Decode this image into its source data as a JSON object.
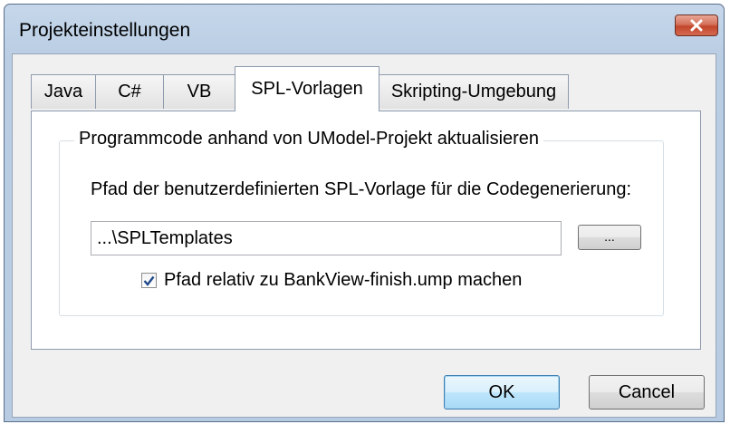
{
  "window": {
    "title": "Projekteinstellungen"
  },
  "tabs": [
    {
      "label": "Java"
    },
    {
      "label": "C#"
    },
    {
      "label": "VB"
    },
    {
      "label": "SPL-Vorlagen",
      "active": true
    },
    {
      "label": "Skripting-Umgebung"
    }
  ],
  "group": {
    "label": "Programmcode anhand von UModel-Projekt aktualisieren",
    "path_label": "Pfad der benutzerdefinierten SPL-Vorlage für die Codegenerierung:",
    "path_value": "...\\SPLTemplates",
    "browse_label": "...",
    "relative_checkbox": {
      "label": "Pfad relativ zu BankView-finish.ump machen",
      "checked": true
    }
  },
  "buttons": {
    "ok": "OK",
    "cancel": "Cancel"
  },
  "colors": {
    "titlebar": "#b9cde3",
    "close": "#c2462c",
    "accent": "#3c7fb1"
  }
}
